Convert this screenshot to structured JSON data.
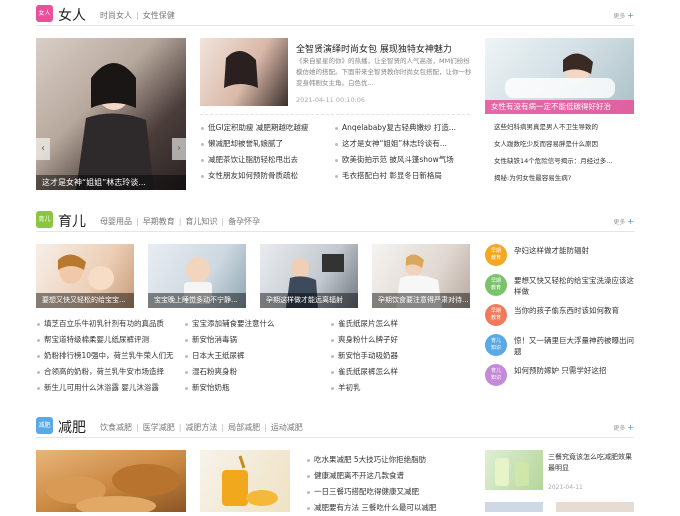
{
  "women": {
    "icon_text": "女人",
    "title": "女人",
    "links": [
      "时尚女人",
      "女性保健"
    ],
    "more": "更多",
    "slide_caption": "这才是女神“姐姐”林志玲谈...",
    "feature": {
      "title": "全智贤演绎时尚女包 展现独特女神魅力",
      "desc": "《来自星星的你》的热播，让全智贤的人气高涨，MM们纷纷模仿她的搭配。下面带来全智贤教你时尚女包搭配，让你一秒变身韩剧女主角。白色优...",
      "date": "2021-04-11 00:10:06"
    },
    "list_left": [
      "低GI定积助瘦 减肥期越吃越瘦",
      "懒减肥却被誉轧娘腻了",
      "减肥茶饮让脂肪轻松甩出去",
      "女性朋友如何预防骨质疏松"
    ],
    "list_right": [
      "Anqelababy复古轻典嫩纱 打造...",
      "这才是女神“姐姐”林志玲谈有...",
      "欧美街拍示范 披风斗篷show气场",
      "毛衣搭配白衬 彰显冬日新格局"
    ],
    "side_caption": "女性有没有病一定不能低碳得好好治",
    "side_list": [
      "这些妇科病男真是男人不卫生导致的",
      "女人跋数吃少反而容易胖是什么原因",
      "女性缺铁14个危险信号揭示：月经过多...",
      "揭秘:为何女性最容易生病?"
    ]
  },
  "parenting": {
    "icon_text": "育儿",
    "title": "育儿",
    "links": [
      "母婴用品",
      "早期教育",
      "育儿知识",
      "备孕怀孕"
    ],
    "more": "更多",
    "captions": [
      "要想又快又轻松的给宝宝...",
      "宝宝晚上睡觉多动不宁静...",
      "孕期这样做才能远离辐射",
      "孕期饮食要注意得严肃对待..."
    ],
    "col1": [
      "填芝百立乐牛初乳针剂有功的真品质",
      "帮宝道特级棉柔婴儿纸尿裤评测",
      "奶粉排行榜10强中，荷兰乳牛荣人们无",
      "合领高的奶粉，荷兰乳牛安市场造择",
      "新生儿可用什么沐浴露 婴儿沐浴露"
    ],
    "col2": [
      "宝宝添加辅食要注意什么",
      "新安怡消毒锅",
      "日本大王纸尿裤",
      "湿石粉爽身粉",
      "新安怡奶瓶"
    ],
    "col3": [
      "雀氏纸尿片怎么样",
      "爽身粉什么牌子好",
      "新安怡手动吸奶器",
      "雀氏纸尿裤怎么样",
      "羊初乳"
    ],
    "badge_items": [
      {
        "badge": "早期\n教育",
        "color": "#f5a623",
        "text": "孕妇这样做才能防辐射"
      },
      {
        "badge": "早期\n教育",
        "color": "#7ac36a",
        "text": "要想又快又轻松的给宝宝洗澡应该这样做"
      },
      {
        "badge": "早期\n教育",
        "color": "#f07a5a",
        "text": "当你的孩子偷东西时该如何教育"
      },
      {
        "badge": "育儿\n知识",
        "color": "#5aa9e6",
        "text": "惊！又一辆里巨大浮量神药被曝出问题"
      },
      {
        "badge": "育儿\n知识",
        "color": "#c48ad8",
        "text": "如何预防嫁妒 只需学好这招"
      }
    ]
  },
  "slim": {
    "icon_text": "减肥",
    "title": "减肥",
    "links": [
      "饮食减肥",
      "医学减肥",
      "减肥方法",
      "局部减肥",
      "运动减肥"
    ],
    "more": "更多",
    "list": [
      "吃水果减肥 5大技巧让你拒绝脂肪",
      "健康减肥离不开这几款食谱",
      "一日三餐巧搭配吃得健康又减肥",
      "减肥要有方法 三餐吃什么最可以减肥"
    ],
    "side_title": "三餐究竟该怎么吃减肥效果最明显",
    "side_date": "2021-04-11"
  },
  "colors": {
    "women": "#e8509a",
    "parenting": "#8cc63f",
    "slim": "#5aa9e6"
  }
}
